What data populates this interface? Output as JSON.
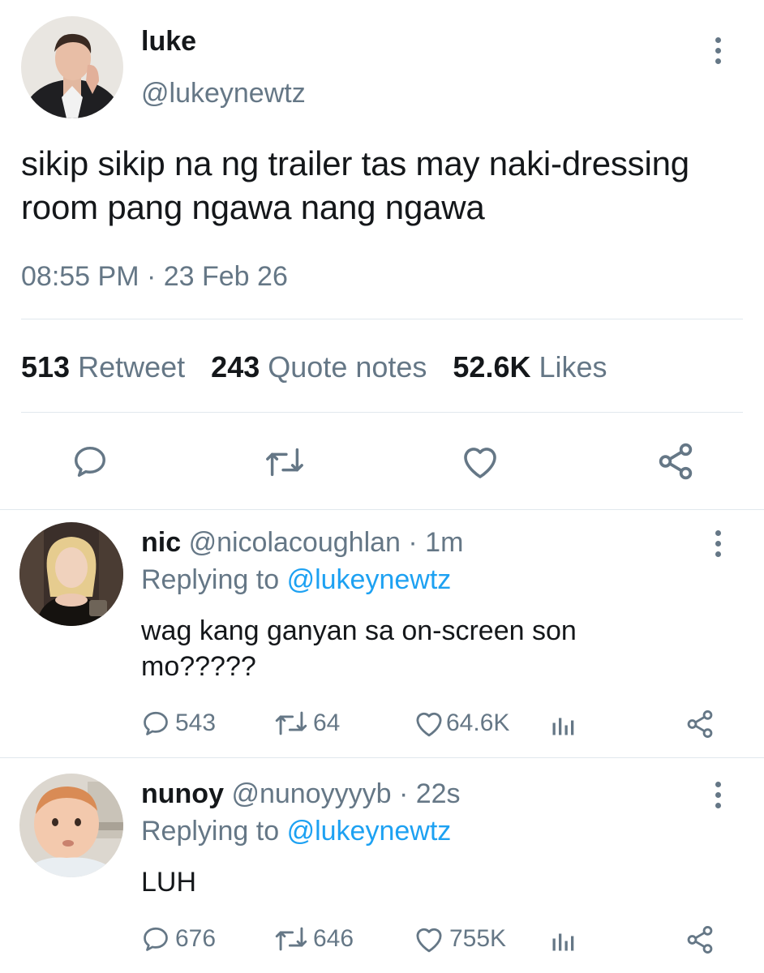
{
  "tweet": {
    "author_name": "luke",
    "author_handle": "@lukeynewtz",
    "text": "sikip sikip na ng trailer tas may naki-dressing room pang ngawa nang ngawa",
    "timestamp": "08:55 PM · 23 Feb 26",
    "stats": {
      "retweets_count": "513",
      "retweets_label": "Retweet",
      "quotes_count": "243",
      "quotes_label": "Quote notes",
      "likes_count": "52.6K",
      "likes_label": "Likes"
    },
    "icons": [
      "reply-icon",
      "retweet-icon",
      "like-icon",
      "share-icon"
    ]
  },
  "replies": [
    {
      "name": "nic",
      "handle": "@nicolacoughlan",
      "time": "1m",
      "replying_prefix": "Replying to",
      "replying_to": "@lukeynewtz",
      "text": "wag kang ganyan sa on-screen son mo?????",
      "reply_count": "543",
      "retweet_count": "64",
      "like_count": "64.6K"
    },
    {
      "name": "nunoy",
      "handle": "@nunoyyyyb",
      "time": "22s",
      "replying_prefix": "Replying to",
      "replying_to": "@lukeynewtz",
      "text": "LUH",
      "reply_count": "676",
      "retweet_count": "646",
      "like_count": "755K"
    }
  ],
  "colors": {
    "text_primary": "#14171a",
    "text_secondary": "#657786",
    "link": "#1da1f2",
    "divider": "#e1e8ed"
  }
}
